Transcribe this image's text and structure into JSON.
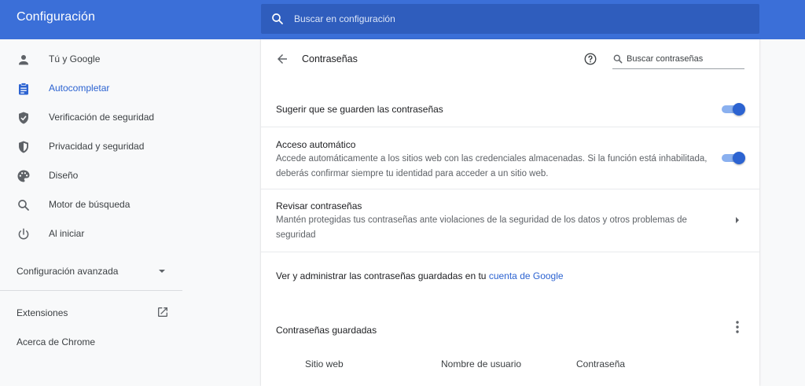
{
  "header": {
    "title": "Configuración",
    "search_placeholder": "Buscar en configuración",
    "bg_color": "#3b6fd8"
  },
  "sidebar": {
    "items": [
      {
        "label": "Tú y Google",
        "icon": "person-icon",
        "active": false
      },
      {
        "label": "Autocompletar",
        "icon": "clipboard-icon",
        "active": true
      },
      {
        "label": "Verificación de seguridad",
        "icon": "shield-check-icon",
        "active": false
      },
      {
        "label": "Privacidad y seguridad",
        "icon": "shield-half-icon",
        "active": false
      },
      {
        "label": "Diseño",
        "icon": "palette-icon",
        "active": false
      },
      {
        "label": "Motor de búsqueda",
        "icon": "search-icon",
        "active": false
      },
      {
        "label": "Al iniciar",
        "icon": "power-icon",
        "active": false
      }
    ],
    "advanced_label": "Configuración avanzada",
    "extensions_label": "Extensiones",
    "about_label": "Acerca de Chrome"
  },
  "passwords": {
    "title": "Contraseñas",
    "search_placeholder": "Buscar contraseñas",
    "offer_to_save": {
      "label": "Sugerir que se guarden las contraseñas",
      "enabled": true
    },
    "auto_signin": {
      "title": "Acceso automático",
      "description": "Accede automáticamente a los sitios web con las credenciales almacenadas. Si la función está inhabilitada, deberás confirmar siempre tu identidad para acceder a un sitio web.",
      "enabled": true
    },
    "check_passwords": {
      "title": "Revisar contraseñas",
      "description": "Mantén protegidas tus contraseñas ante violaciones de la seguridad de los datos y otros problemas de seguridad"
    },
    "manage_text": "Ver y administrar las contraseñas guardadas en tu",
    "manage_link": "cuenta de Google",
    "saved_title": "Contraseñas guardadas",
    "columns": [
      "Sitio web",
      "Nombre de usuario",
      "Contraseña"
    ]
  },
  "colors": {
    "accent": "#2c63d1",
    "toggle_track": "#8ab0ef"
  }
}
